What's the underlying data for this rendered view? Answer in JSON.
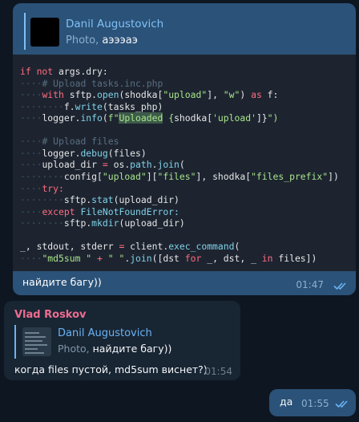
{
  "messages": [
    {
      "reply": {
        "name": "Danil Augustovich",
        "kind": "Photo,",
        "caption": "аэээаэ"
      },
      "code_lines": [
        [
          [
            "if ",
            "kw"
          ],
          [
            "not ",
            "kw"
          ],
          [
            "args",
            "txt"
          ],
          [
            ".dry:",
            "txt"
          ]
        ],
        [
          [
            "····",
            "ind"
          ],
          [
            "# Upload tasks.inc.php",
            "cm"
          ]
        ],
        [
          [
            "····",
            "ind"
          ],
          [
            "with ",
            "kw"
          ],
          [
            "sftp",
            "txt"
          ],
          [
            ".",
            "txt"
          ],
          [
            "open",
            "fn"
          ],
          [
            "(shodka[",
            "txt"
          ],
          [
            "\"upload\"",
            "str"
          ],
          [
            "], ",
            "txt"
          ],
          [
            "\"w\"",
            "str"
          ],
          [
            ") ",
            "txt"
          ],
          [
            "as ",
            "kw"
          ],
          [
            "f:",
            "txt"
          ]
        ],
        [
          [
            "········",
            "ind"
          ],
          [
            "f",
            "txt"
          ],
          [
            ".",
            "txt"
          ],
          [
            "write",
            "fn"
          ],
          [
            "(tasks_php)",
            "txt"
          ]
        ],
        [
          [
            "····",
            "ind"
          ],
          [
            "logger",
            "txt"
          ],
          [
            ".",
            "txt"
          ],
          [
            "info",
            "fn"
          ],
          [
            "(",
            "txt"
          ],
          [
            "f\"",
            "str"
          ],
          [
            "Uploaded",
            "hl"
          ],
          [
            " {",
            "str"
          ],
          [
            "shodka[",
            "txt"
          ],
          [
            "'upload'",
            "str"
          ],
          [
            "]}",
            "txt"
          ],
          [
            "\")",
            "str"
          ]
        ],
        [],
        [
          [
            "····",
            "ind"
          ],
          [
            "# Upload files",
            "cm"
          ]
        ],
        [
          [
            "····",
            "ind"
          ],
          [
            "logger",
            "txt"
          ],
          [
            ".",
            "txt"
          ],
          [
            "debug",
            "fn"
          ],
          [
            "(files)",
            "txt"
          ]
        ],
        [
          [
            "····",
            "ind"
          ],
          [
            "upload_dir ",
            "txt"
          ],
          [
            "= ",
            "op"
          ],
          [
            "os",
            "txt"
          ],
          [
            ".",
            "txt"
          ],
          [
            "path",
            "fn"
          ],
          [
            ".",
            "txt"
          ],
          [
            "join",
            "fn"
          ],
          [
            "(",
            "txt"
          ]
        ],
        [
          [
            "········",
            "ind"
          ],
          [
            "config[",
            "txt"
          ],
          [
            "\"upload\"",
            "str"
          ],
          [
            "][",
            "txt"
          ],
          [
            "\"files\"",
            "str"
          ],
          [
            "], shodka[",
            "txt"
          ],
          [
            "\"files_prefix\"",
            "str"
          ],
          [
            "])",
            "txt"
          ]
        ],
        [
          [
            "····",
            "ind"
          ],
          [
            "try:",
            "kw"
          ]
        ],
        [
          [
            "········",
            "ind"
          ],
          [
            "sftp",
            "txt"
          ],
          [
            ".",
            "txt"
          ],
          [
            "stat",
            "fn"
          ],
          [
            "(upload_dir)",
            "txt"
          ]
        ],
        [
          [
            "····",
            "ind"
          ],
          [
            "except ",
            "kw"
          ],
          [
            "FileNotFoundError:",
            "fn"
          ]
        ],
        [
          [
            "········",
            "ind"
          ],
          [
            "sftp",
            "txt"
          ],
          [
            ".",
            "txt"
          ],
          [
            "mkdir",
            "fn"
          ],
          [
            "(upload_dir)",
            "txt"
          ]
        ],
        [],
        [
          [
            "_, stdout, stderr ",
            "txt"
          ],
          [
            "= ",
            "op"
          ],
          [
            "client",
            "txt"
          ],
          [
            ".",
            "txt"
          ],
          [
            "exec_command",
            "fn"
          ],
          [
            "(",
            "txt"
          ]
        ],
        [
          [
            "····",
            "ind"
          ],
          [
            "\"md5sum \"",
            "str"
          ],
          [
            " + ",
            "op"
          ],
          [
            "\" \"",
            "str"
          ],
          [
            ".",
            "txt"
          ],
          [
            "join",
            "fn"
          ],
          [
            "([dst ",
            "txt"
          ],
          [
            "for ",
            "kw"
          ],
          [
            "_, dst, _ ",
            "txt"
          ],
          [
            "in ",
            "kw"
          ],
          [
            "files])",
            "txt"
          ]
        ]
      ],
      "caption": "найдите багу))",
      "time": "01:47"
    },
    {
      "sender": "Vlad Roskov",
      "reply": {
        "name": "Danil Augustovich",
        "kind": "Photo,",
        "caption": "найдите багу))"
      },
      "text": "когда files пустой, md5sum виснет?)",
      "time": "01:54"
    },
    {
      "text": "да",
      "time": "01:55"
    }
  ],
  "colors": {
    "chat_bg": "#0e1621",
    "outgoing_bubble": "#2b5278",
    "incoming_bubble": "#182533",
    "sender_name": "#ee6c8f",
    "reply_name": "#7fc1f7"
  },
  "icons": {
    "read_receipt": "double-check-icon"
  }
}
